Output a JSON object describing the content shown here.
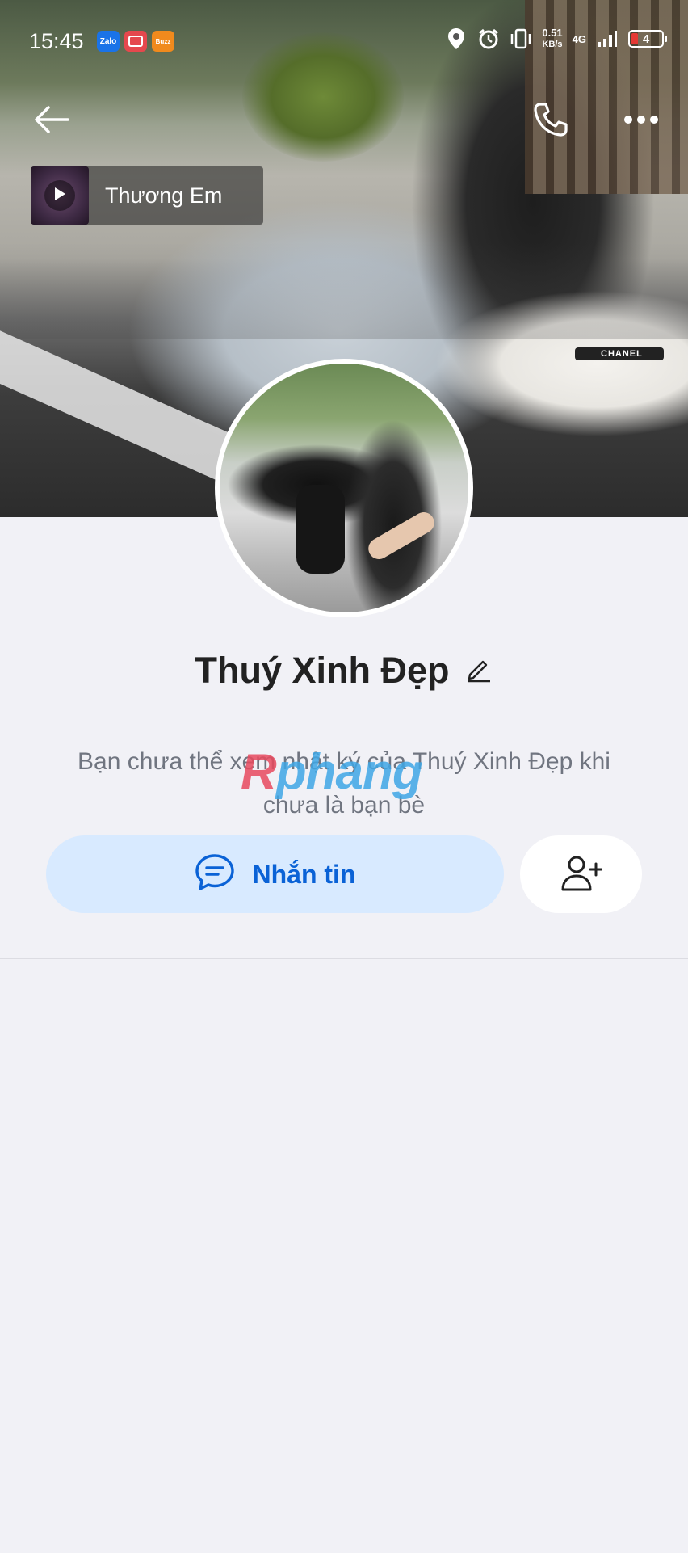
{
  "status_bar": {
    "time": "15:45",
    "apps": [
      "Zalo",
      "Vidcam",
      "Buzz"
    ],
    "net_speed_value": "0.51",
    "net_speed_unit": "KB/s",
    "network": "4G",
    "battery": "4"
  },
  "header": {
    "back_icon": "arrow-left-icon",
    "call_icon": "phone-icon",
    "more_icon": "more-dots-icon"
  },
  "cover": {
    "hat_text": "CHANEL"
  },
  "music": {
    "title": "Thương Em"
  },
  "profile": {
    "name": "Thuý Xinh Đẹp"
  },
  "info": {
    "line1": "Bạn chưa thể xem nhật ký của Thuý Xinh Đẹp khi",
    "line2": "chưa là bạn bè",
    "watermark_part1": "R",
    "watermark_part2": "phang"
  },
  "actions": {
    "message_label": "Nhắn tin",
    "add_friend_icon": "add-friend-icon"
  },
  "colors": {
    "accent": "#0a62d6",
    "accent_bg": "#d8eaff",
    "page_bg": "#f1f1f6"
  }
}
